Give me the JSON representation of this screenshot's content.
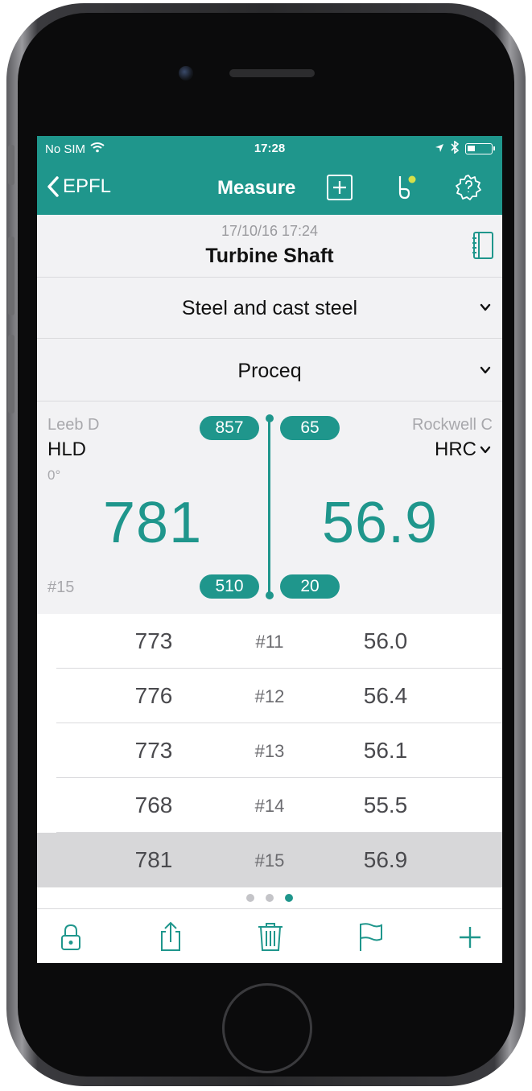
{
  "status_bar": {
    "carrier": "No SIM",
    "time": "17:28",
    "battery_level": 0.35
  },
  "nav": {
    "back_label": "EPFL",
    "title": "Measure",
    "icons": [
      "add-square-icon",
      "probe-icon",
      "settings-gear-icon"
    ],
    "probe_status_color": "#d6e04a"
  },
  "info": {
    "date": "17/10/16 17:24",
    "name": "Turbine Shaft"
  },
  "material": {
    "label": "Steel and cast steel"
  },
  "conversion": {
    "label": "Proceq"
  },
  "measurement": {
    "left_scale_name": "Leeb D",
    "left_unit": "HLD",
    "angle": "0°",
    "left_value": "781",
    "index": "#15",
    "right_scale_name": "Rockwell C",
    "right_unit": "HRC",
    "right_value": "56.9",
    "left_max": "857",
    "left_min": "510",
    "right_max": "65",
    "right_min": "20"
  },
  "rows": [
    {
      "hld": "773",
      "index": "#11",
      "hrc": "56.0",
      "selected": false
    },
    {
      "hld": "776",
      "index": "#12",
      "hrc": "56.4",
      "selected": false
    },
    {
      "hld": "773",
      "index": "#13",
      "hrc": "56.1",
      "selected": false
    },
    {
      "hld": "768",
      "index": "#14",
      "hrc": "55.5",
      "selected": false
    },
    {
      "hld": "781",
      "index": "#15",
      "hrc": "56.9",
      "selected": true
    }
  ],
  "pager": {
    "pages": 3,
    "active": 3
  },
  "toolbar": {
    "icons": [
      "lock-icon",
      "share-icon",
      "trash-icon",
      "flag-icon",
      "add-icon"
    ]
  },
  "colors": {
    "accent": "#1f968c",
    "selected_row": "#d7d7d9"
  }
}
